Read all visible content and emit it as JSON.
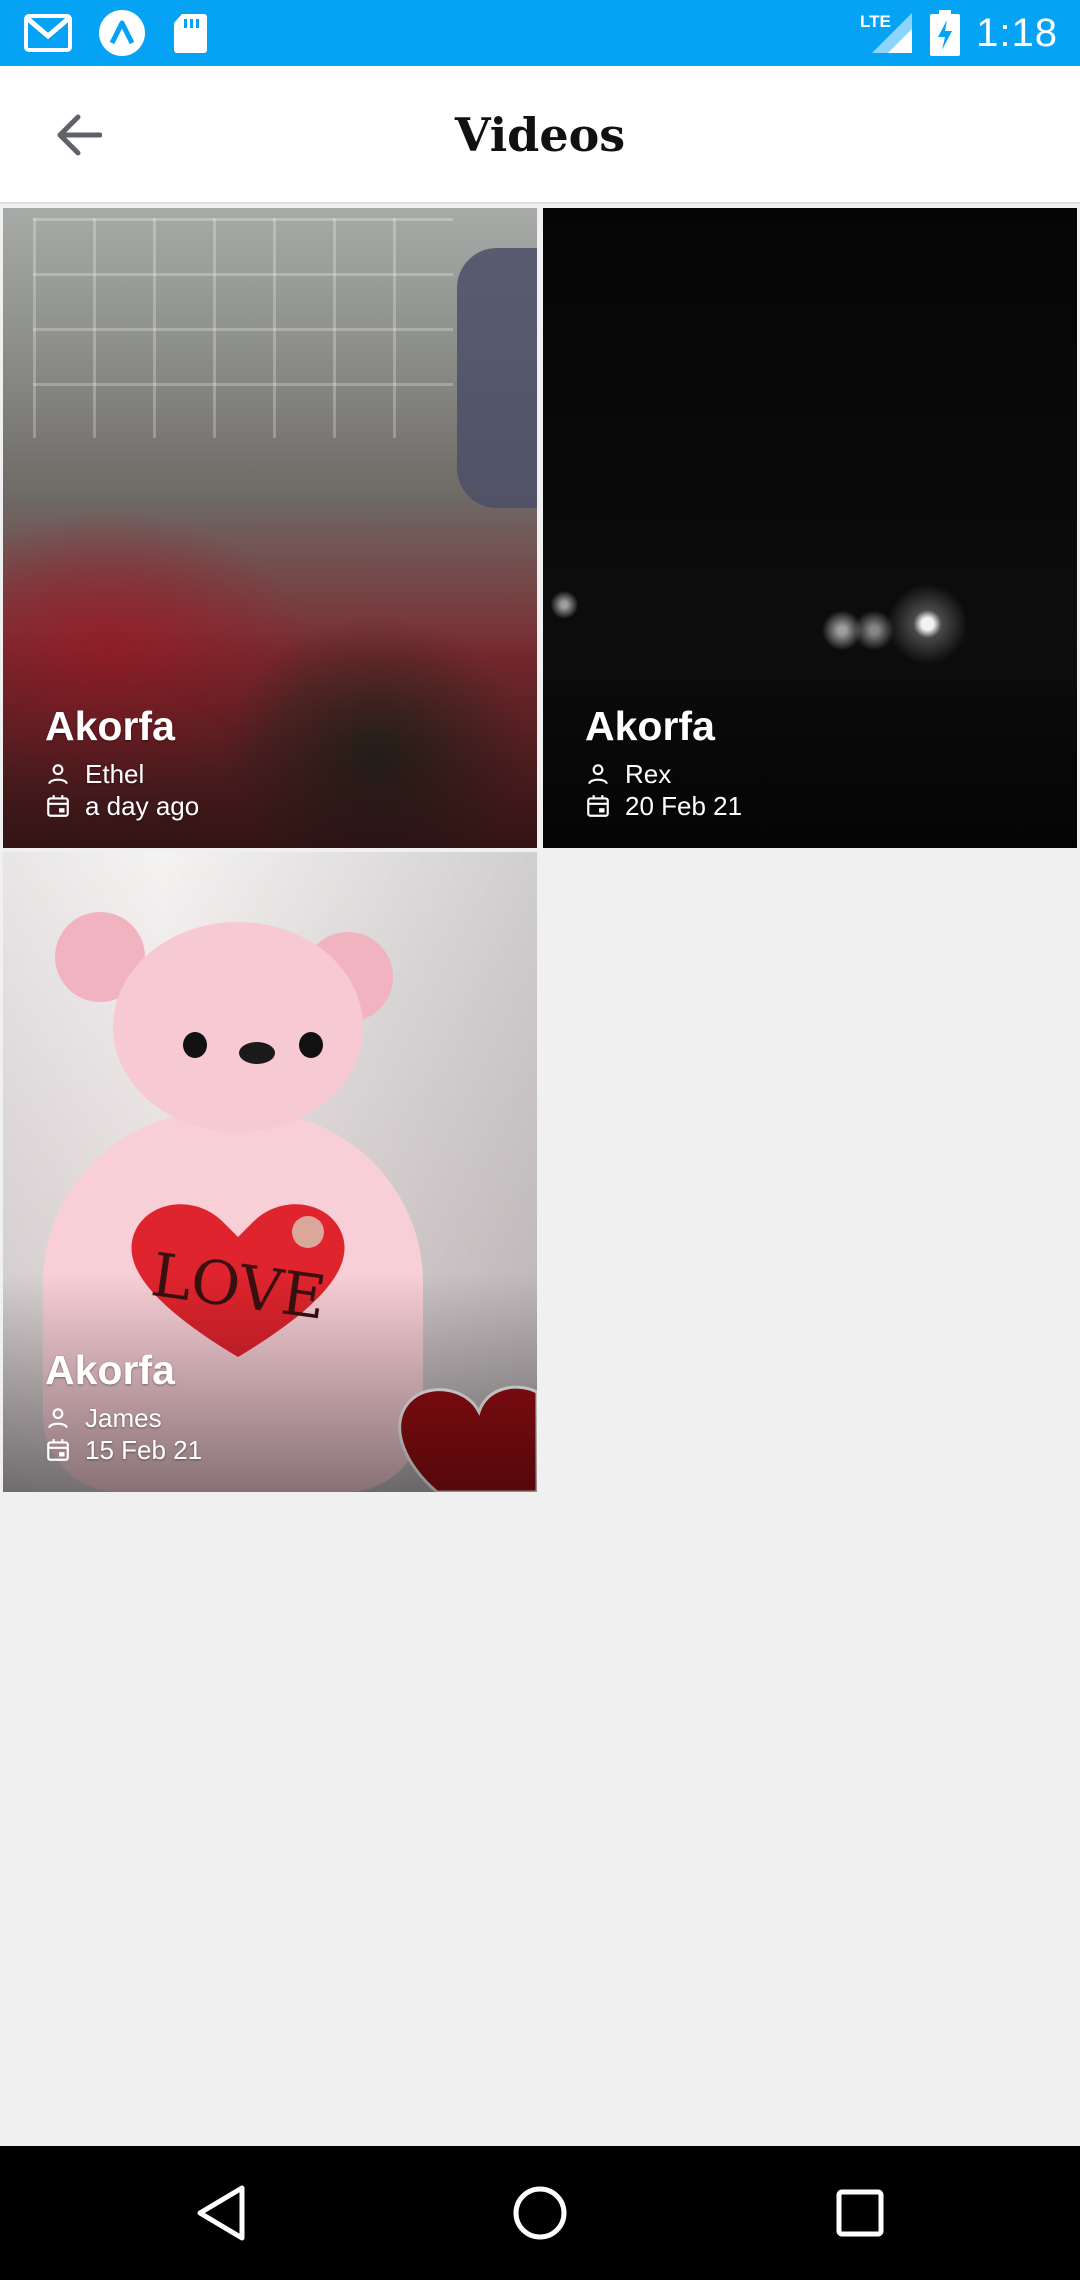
{
  "status_bar": {
    "time": "1:18",
    "network": "LTE",
    "icons": [
      "gmail-icon",
      "app-icon",
      "sd-card-icon",
      "signal-icon",
      "battery-charging-icon"
    ]
  },
  "app_bar": {
    "title": "Videos",
    "back_icon": "arrow-back-icon"
  },
  "videos": [
    {
      "title": "Akorfa",
      "author": "Ethel",
      "date": "a day ago"
    },
    {
      "title": "Akorfa",
      "author": "Rex",
      "date": "20 Feb 21"
    },
    {
      "title": "Akorfa",
      "author": "James",
      "date": "15 Feb 21",
      "thumbnail_text": "LOVE"
    }
  ],
  "nav_bar": {
    "items": [
      "back-nav-icon",
      "home-nav-icon",
      "recents-nav-icon"
    ]
  },
  "colors": {
    "status_bar": "#06a3f5",
    "background": "#f1f0f0",
    "app_bar": "#ffffff",
    "nav_bar": "#000000"
  }
}
